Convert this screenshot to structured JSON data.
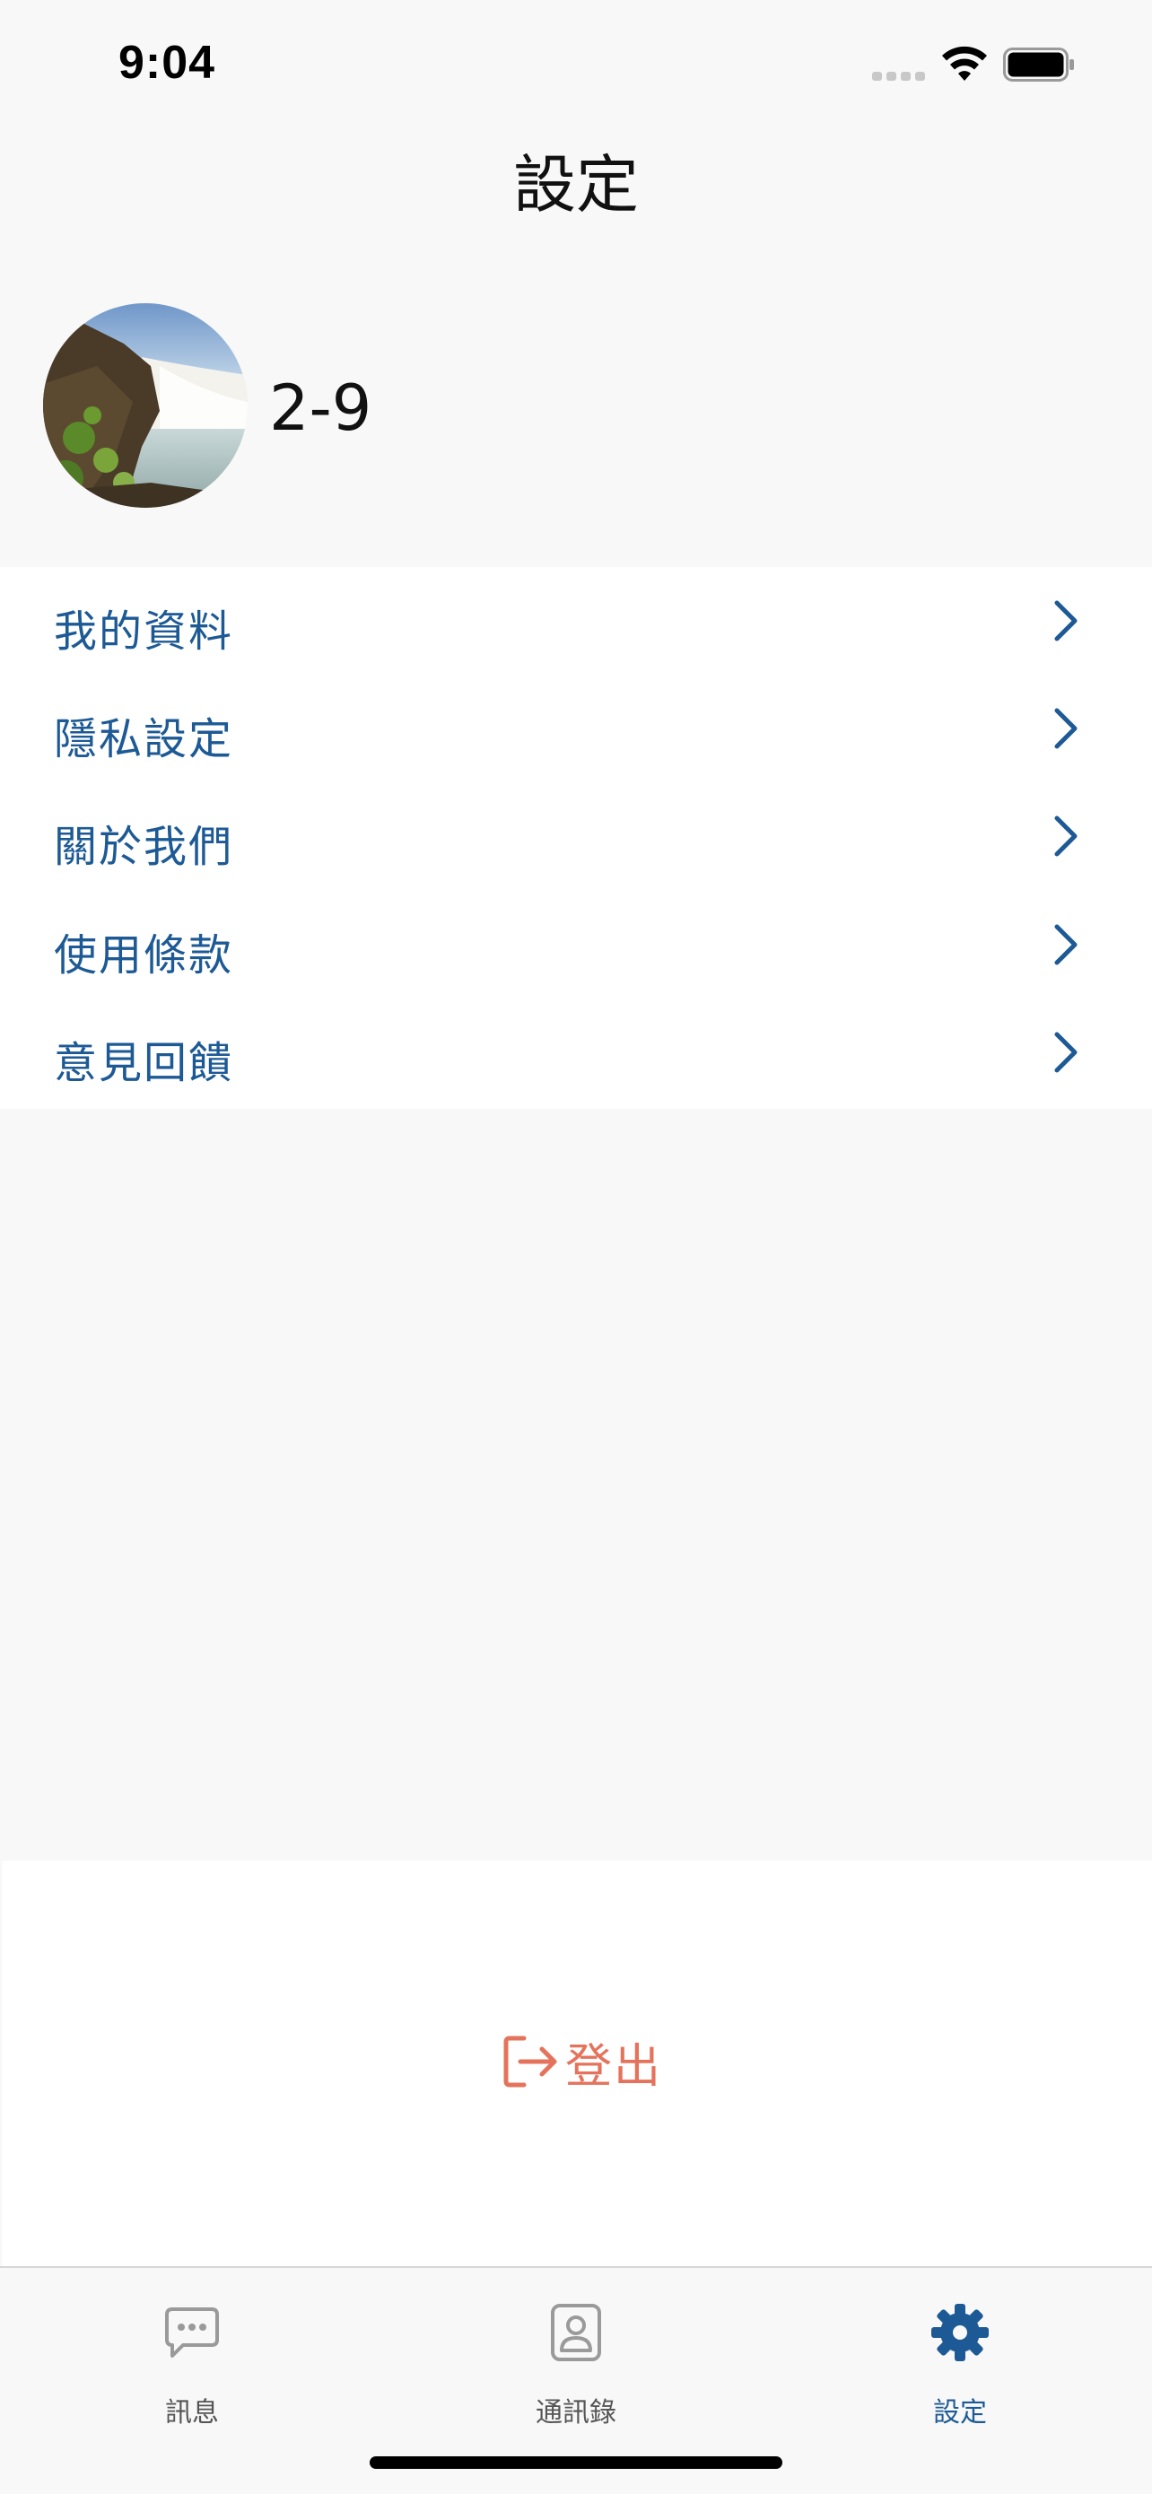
{
  "status_bar": {
    "time": "9:04"
  },
  "header": {
    "title": "設定"
  },
  "profile": {
    "name": "2-9"
  },
  "menu": {
    "items": [
      {
        "label": "我的資料"
      },
      {
        "label": "隱私設定"
      },
      {
        "label": "關於我們"
      },
      {
        "label": "使用條款"
      },
      {
        "label": "意見回饋"
      }
    ]
  },
  "logout": {
    "label": "登出",
    "color": "#e5735c"
  },
  "tab_bar": {
    "tabs": [
      {
        "label": "訊息",
        "icon": "chat-bubble-icon",
        "active": false
      },
      {
        "label": "通訊錄",
        "icon": "contact-card-icon",
        "active": false
      },
      {
        "label": "設定",
        "icon": "gear-icon",
        "active": true
      }
    ]
  },
  "colors": {
    "accent": "#1d5a95",
    "inactive": "#555555",
    "background": "#f8f8f8",
    "danger": "#e5735c"
  }
}
